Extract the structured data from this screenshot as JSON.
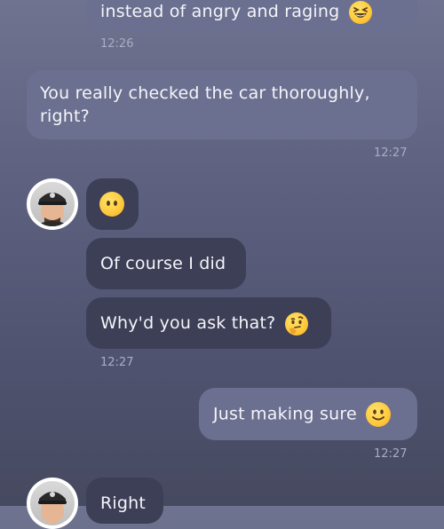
{
  "messages": {
    "m1": {
      "text": "instead of angry and raging",
      "emoji": "grinning-squinting-face-emoji",
      "time": "12:26"
    },
    "m2": {
      "line1": "You really checked the car thoroughly,",
      "line2": "right?",
      "time": "12:27"
    },
    "m3": {
      "emoji": "neutral-face-emoji"
    },
    "m4": {
      "text": "Of course I did"
    },
    "m5": {
      "text": "Why'd you ask that?",
      "emoji": "thinking-face-emoji",
      "time": "12:27"
    },
    "m6": {
      "text": "Just making sure",
      "emoji": "slightly-smiling-face-emoji",
      "time": "12:27"
    },
    "m7": {
      "text": "Right"
    }
  },
  "colors": {
    "incoming_bubble": "#3c3f56",
    "outgoing_bubble": "#6c7090",
    "timestamp": "#a9adc2"
  }
}
